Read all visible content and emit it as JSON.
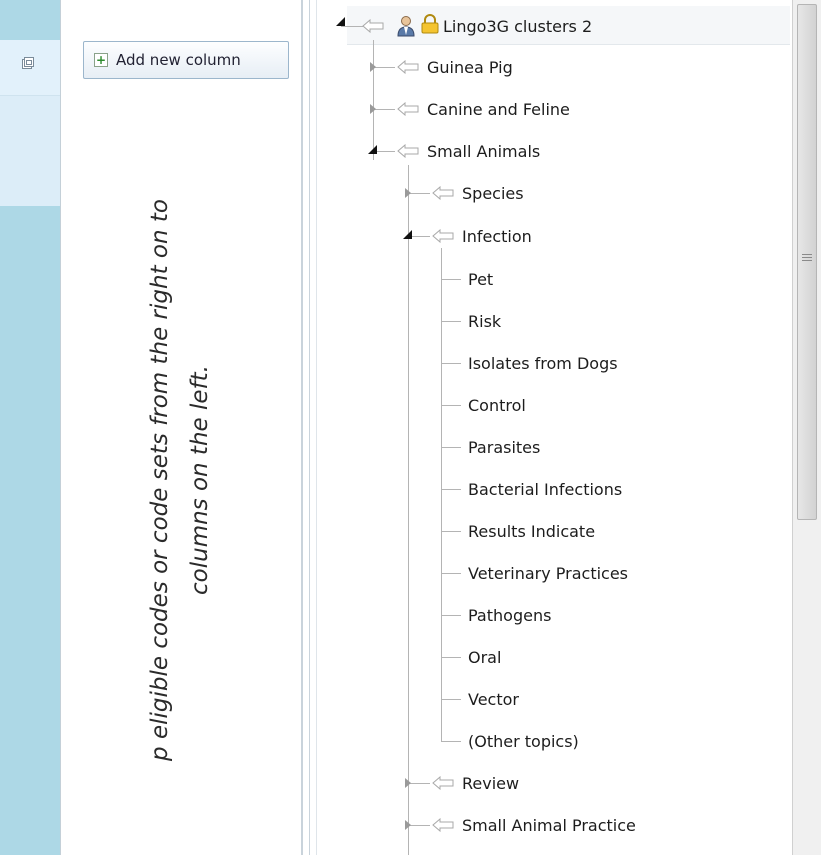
{
  "toolbar": {
    "add_column_label": "Add new column",
    "add_column_icon": "plus-icon"
  },
  "instruction": {
    "line1": "p eligible codes or code sets from the right on to",
    "line2": "columns on the left."
  },
  "tree": {
    "root": {
      "label": "Lingo3G clusters 2",
      "icons": [
        "arrow-left-icon",
        "person-icon",
        "lock-icon"
      ]
    },
    "level1": [
      {
        "label": "Guinea Pig",
        "expanded": false
      },
      {
        "label": "Canine and Feline",
        "expanded": false
      },
      {
        "label": "Small Animals",
        "expanded": true
      }
    ],
    "small_animals_children": [
      {
        "label": "Species",
        "expanded": false
      },
      {
        "label": "Infection",
        "expanded": true
      }
    ],
    "infection_children": [
      "Pet",
      "Risk",
      "Isolates from Dogs",
      "Control",
      "Parasites",
      "Bacterial Infections",
      "Results Indicate",
      "Veterinary Practices",
      "Pathogens",
      "Oral",
      "Vector",
      "(Other topics)"
    ],
    "small_animals_more": [
      {
        "label": "Review",
        "expanded": false
      },
      {
        "label": "Small Animal Practice",
        "expanded": false
      }
    ]
  },
  "colors": {
    "panel_blue": "#add8e6",
    "panel_header": "#e2f1fb",
    "tree_line": "#b4b4b4"
  }
}
